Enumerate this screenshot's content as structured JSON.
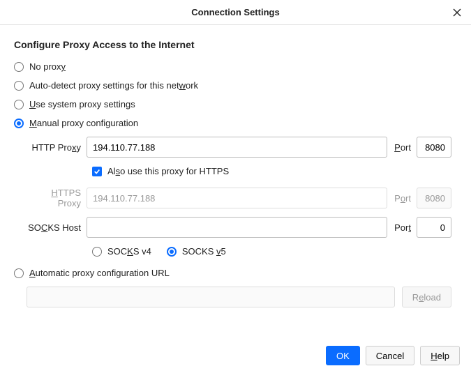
{
  "dialog": {
    "title": "Connection Settings"
  },
  "section": {
    "heading": "Configure Proxy Access to the Internet"
  },
  "options": {
    "no_proxy_pre": "No prox",
    "no_proxy_u": "y",
    "autodetect_pre": "Auto-detect proxy settings for this net",
    "autodetect_u": "w",
    "autodetect_post": "ork",
    "system_pre": "",
    "system_u": "U",
    "system_post": "se system proxy settings",
    "manual_pre": "",
    "manual_u": "M",
    "manual_post": "anual proxy configuration",
    "auto_url_pre": "",
    "auto_url_u": "A",
    "auto_url_post": "utomatic proxy configuration URL"
  },
  "http": {
    "label_pre": "HTTP Pro",
    "label_u": "x",
    "label_post": "y",
    "host": "194.110.77.188",
    "port_label_pre": "",
    "port_label_u": "P",
    "port_label_post": "ort",
    "port": "8080"
  },
  "also_https": {
    "label_pre": "Al",
    "label_u": "s",
    "label_post": "o use this proxy for HTTPS"
  },
  "https": {
    "label_pre": "",
    "label_u": "H",
    "label_post": "TTPS Proxy",
    "host": "194.110.77.188",
    "port_label_pre": "P",
    "port_label_u": "o",
    "port_label_post": "rt",
    "port": "8080"
  },
  "socks": {
    "label_pre": "SO",
    "label_u": "C",
    "label_post": "KS Host",
    "host": "",
    "port_label_pre": "Por",
    "port_label_u": "t",
    "port_label_post": "",
    "port": "0",
    "v4_pre": "SOC",
    "v4_u": "K",
    "v4_post": "S v4",
    "v5_pre": "SOCKS ",
    "v5_u": "v",
    "v5_post": "5"
  },
  "pac": {
    "url": "",
    "reload_pre": "R",
    "reload_u": "e",
    "reload_post": "load"
  },
  "footer": {
    "ok": "OK",
    "cancel": "Cancel",
    "help_u": "H",
    "help_post": "elp"
  }
}
